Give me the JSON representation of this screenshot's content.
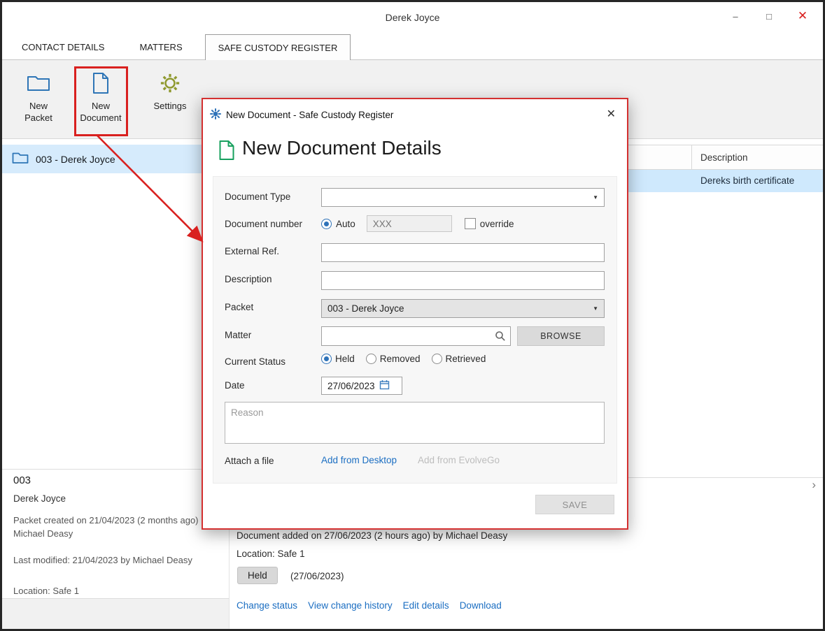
{
  "window": {
    "title": "Derek Joyce",
    "controls": {
      "minimize": "–",
      "maximize": "□",
      "close": "✕"
    }
  },
  "tabs": [
    {
      "label": "CONTACT DETAILS"
    },
    {
      "label": "MATTERS"
    },
    {
      "label": "SAFE CUSTODY REGISTER"
    }
  ],
  "toolbar": {
    "items": [
      {
        "line1": "New",
        "line2": "Packet"
      },
      {
        "line1": "New",
        "line2": "Document"
      },
      {
        "line1": "Settings",
        "line2": ""
      }
    ]
  },
  "packet_list": {
    "selected_item": {
      "label": "003  -  Derek Joyce"
    }
  },
  "table": {
    "header": {
      "description": "Description"
    },
    "rows": [
      {
        "description": "Dereks birth certificate"
      }
    ]
  },
  "left_details": {
    "id": "003",
    "name": "Derek Joyce",
    "created": "Packet created on 21/04/2023 (2 months ago) by Michael Deasy",
    "modified": "Last modified: 21/04/2023 by Michael Deasy",
    "location": "Location: Safe 1"
  },
  "right_details": {
    "added": "Document added on 27/06/2023 (2 hours ago) by Michael Deasy",
    "location": "Location: Safe 1",
    "status_badge": "Held",
    "status_date": "(27/06/2023)",
    "links": [
      "Change status",
      "View change history",
      "Edit details",
      "Download"
    ],
    "collapse_chevron": "›"
  },
  "dialog": {
    "title": "New Document - Safe Custody Register",
    "close": "✕",
    "heading": "New Document Details",
    "fields": {
      "document_type_label": "Document Type",
      "document_number_label": "Document number",
      "auto_label": "Auto",
      "auto_placeholder": "XXX",
      "override_label": "override",
      "external_ref_label": "External Ref.",
      "description_label": "Description",
      "packet_label": "Packet",
      "packet_value": "003 - Derek Joyce",
      "matter_label": "Matter",
      "browse_label": "BROWSE",
      "current_status_label": "Current Status",
      "status_options": [
        "Held",
        "Removed",
        "Retrieved"
      ],
      "date_label": "Date",
      "date_value": "27/06/2023",
      "reason_placeholder": "Reason",
      "attach_label": "Attach a file",
      "add_desktop": "Add from Desktop",
      "add_evolvego": "Add from EvolveGo"
    },
    "save_label": "SAVE"
  },
  "icons": {
    "dropdown_arrow": "▼"
  },
  "colors": {
    "accent_blue": "#2e72b8",
    "link_blue": "#1b6ec2",
    "selection_blue": "#cfe9fd",
    "annotation_red": "#d9201f",
    "icon_green": "#17a05e"
  }
}
